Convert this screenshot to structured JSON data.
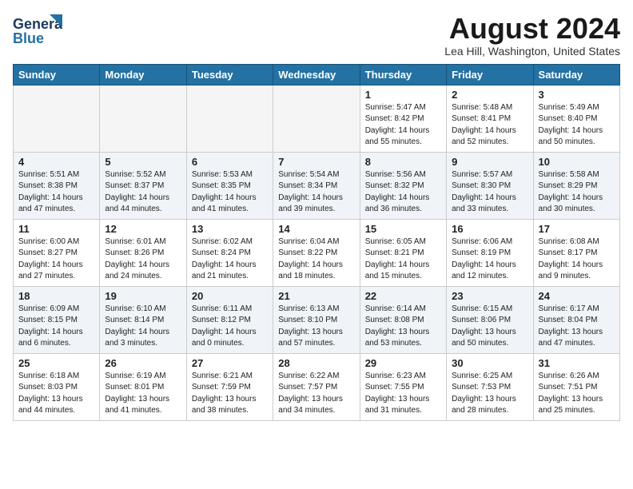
{
  "header": {
    "logo_line1": "General",
    "logo_line2": "Blue",
    "month_title": "August 2024",
    "location": "Lea Hill, Washington, United States"
  },
  "weekdays": [
    "Sunday",
    "Monday",
    "Tuesday",
    "Wednesday",
    "Thursday",
    "Friday",
    "Saturday"
  ],
  "weeks": [
    [
      {
        "day": "",
        "info": ""
      },
      {
        "day": "",
        "info": ""
      },
      {
        "day": "",
        "info": ""
      },
      {
        "day": "",
        "info": ""
      },
      {
        "day": "1",
        "info": "Sunrise: 5:47 AM\nSunset: 8:42 PM\nDaylight: 14 hours\nand 55 minutes."
      },
      {
        "day": "2",
        "info": "Sunrise: 5:48 AM\nSunset: 8:41 PM\nDaylight: 14 hours\nand 52 minutes."
      },
      {
        "day": "3",
        "info": "Sunrise: 5:49 AM\nSunset: 8:40 PM\nDaylight: 14 hours\nand 50 minutes."
      }
    ],
    [
      {
        "day": "4",
        "info": "Sunrise: 5:51 AM\nSunset: 8:38 PM\nDaylight: 14 hours\nand 47 minutes."
      },
      {
        "day": "5",
        "info": "Sunrise: 5:52 AM\nSunset: 8:37 PM\nDaylight: 14 hours\nand 44 minutes."
      },
      {
        "day": "6",
        "info": "Sunrise: 5:53 AM\nSunset: 8:35 PM\nDaylight: 14 hours\nand 41 minutes."
      },
      {
        "day": "7",
        "info": "Sunrise: 5:54 AM\nSunset: 8:34 PM\nDaylight: 14 hours\nand 39 minutes."
      },
      {
        "day": "8",
        "info": "Sunrise: 5:56 AM\nSunset: 8:32 PM\nDaylight: 14 hours\nand 36 minutes."
      },
      {
        "day": "9",
        "info": "Sunrise: 5:57 AM\nSunset: 8:30 PM\nDaylight: 14 hours\nand 33 minutes."
      },
      {
        "day": "10",
        "info": "Sunrise: 5:58 AM\nSunset: 8:29 PM\nDaylight: 14 hours\nand 30 minutes."
      }
    ],
    [
      {
        "day": "11",
        "info": "Sunrise: 6:00 AM\nSunset: 8:27 PM\nDaylight: 14 hours\nand 27 minutes."
      },
      {
        "day": "12",
        "info": "Sunrise: 6:01 AM\nSunset: 8:26 PM\nDaylight: 14 hours\nand 24 minutes."
      },
      {
        "day": "13",
        "info": "Sunrise: 6:02 AM\nSunset: 8:24 PM\nDaylight: 14 hours\nand 21 minutes."
      },
      {
        "day": "14",
        "info": "Sunrise: 6:04 AM\nSunset: 8:22 PM\nDaylight: 14 hours\nand 18 minutes."
      },
      {
        "day": "15",
        "info": "Sunrise: 6:05 AM\nSunset: 8:21 PM\nDaylight: 14 hours\nand 15 minutes."
      },
      {
        "day": "16",
        "info": "Sunrise: 6:06 AM\nSunset: 8:19 PM\nDaylight: 14 hours\nand 12 minutes."
      },
      {
        "day": "17",
        "info": "Sunrise: 6:08 AM\nSunset: 8:17 PM\nDaylight: 14 hours\nand 9 minutes."
      }
    ],
    [
      {
        "day": "18",
        "info": "Sunrise: 6:09 AM\nSunset: 8:15 PM\nDaylight: 14 hours\nand 6 minutes."
      },
      {
        "day": "19",
        "info": "Sunrise: 6:10 AM\nSunset: 8:14 PM\nDaylight: 14 hours\nand 3 minutes."
      },
      {
        "day": "20",
        "info": "Sunrise: 6:11 AM\nSunset: 8:12 PM\nDaylight: 14 hours\nand 0 minutes."
      },
      {
        "day": "21",
        "info": "Sunrise: 6:13 AM\nSunset: 8:10 PM\nDaylight: 13 hours\nand 57 minutes."
      },
      {
        "day": "22",
        "info": "Sunrise: 6:14 AM\nSunset: 8:08 PM\nDaylight: 13 hours\nand 53 minutes."
      },
      {
        "day": "23",
        "info": "Sunrise: 6:15 AM\nSunset: 8:06 PM\nDaylight: 13 hours\nand 50 minutes."
      },
      {
        "day": "24",
        "info": "Sunrise: 6:17 AM\nSunset: 8:04 PM\nDaylight: 13 hours\nand 47 minutes."
      }
    ],
    [
      {
        "day": "25",
        "info": "Sunrise: 6:18 AM\nSunset: 8:03 PM\nDaylight: 13 hours\nand 44 minutes."
      },
      {
        "day": "26",
        "info": "Sunrise: 6:19 AM\nSunset: 8:01 PM\nDaylight: 13 hours\nand 41 minutes."
      },
      {
        "day": "27",
        "info": "Sunrise: 6:21 AM\nSunset: 7:59 PM\nDaylight: 13 hours\nand 38 minutes."
      },
      {
        "day": "28",
        "info": "Sunrise: 6:22 AM\nSunset: 7:57 PM\nDaylight: 13 hours\nand 34 minutes."
      },
      {
        "day": "29",
        "info": "Sunrise: 6:23 AM\nSunset: 7:55 PM\nDaylight: 13 hours\nand 31 minutes."
      },
      {
        "day": "30",
        "info": "Sunrise: 6:25 AM\nSunset: 7:53 PM\nDaylight: 13 hours\nand 28 minutes."
      },
      {
        "day": "31",
        "info": "Sunrise: 6:26 AM\nSunset: 7:51 PM\nDaylight: 13 hours\nand 25 minutes."
      }
    ]
  ]
}
